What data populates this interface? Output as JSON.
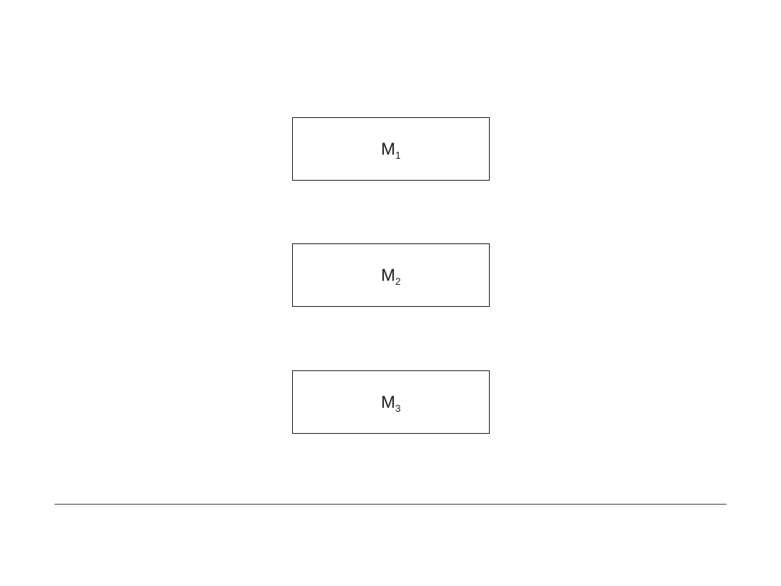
{
  "diagram": {
    "boxes": [
      {
        "letter": "M",
        "index": "1"
      },
      {
        "letter": "M",
        "index": "2"
      },
      {
        "letter": "M",
        "index": "3"
      }
    ]
  }
}
